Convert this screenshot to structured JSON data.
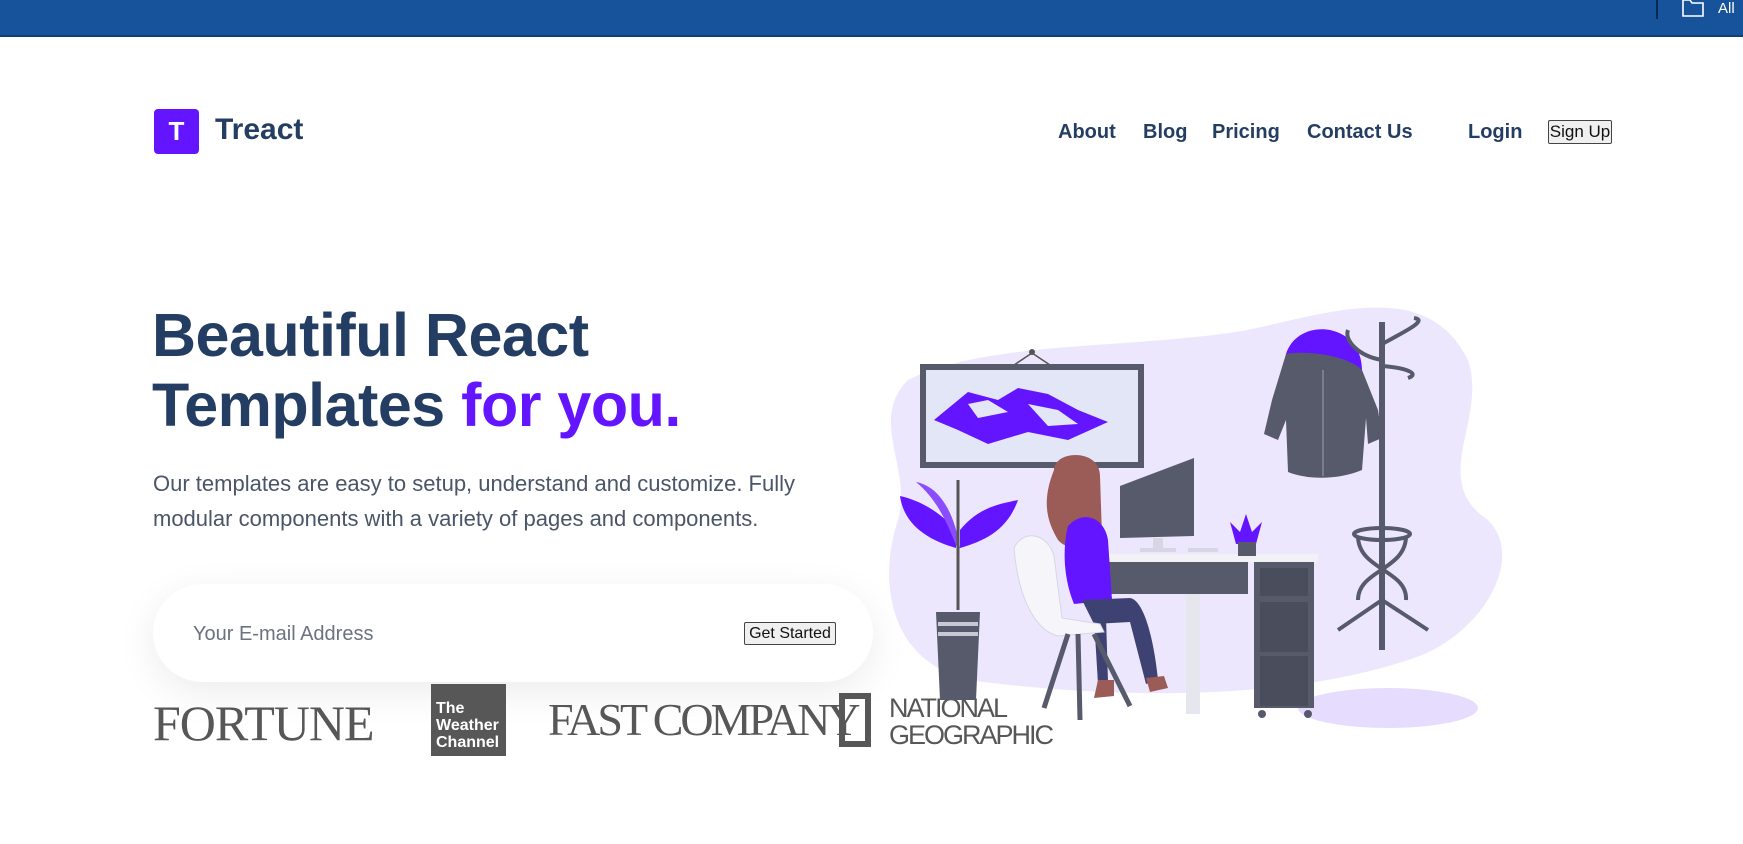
{
  "browser_bar": {
    "bookmark_label": "All",
    "bg_color": "#17539b"
  },
  "header": {
    "logo_letter": "T",
    "brand": "Treact",
    "nav": [
      "About",
      "Blog",
      "Pricing",
      "Contact Us"
    ],
    "login": "Login",
    "signup": "Sign Up",
    "accent_color": "#6415ff",
    "text_color": "#243e63"
  },
  "hero": {
    "title_line1": "Beautiful React",
    "title_line2": "Templates",
    "title_accent": "for you.",
    "description": "Our templates are easy to setup, understand and customize. Fully modular components with a variety of pages and components.",
    "email_placeholder": "Your E-mail Address",
    "cta": "Get Started"
  },
  "customers": {
    "fortune": "FORTUNE",
    "weather": [
      "The",
      "Weather",
      "Channel"
    ],
    "fastcompany": "FAST COMPANY",
    "natgeo": [
      "NATIONAL",
      "GEOGRAPHIC"
    ]
  },
  "illustration": {
    "icon": "woman-at-desk-illustration"
  }
}
